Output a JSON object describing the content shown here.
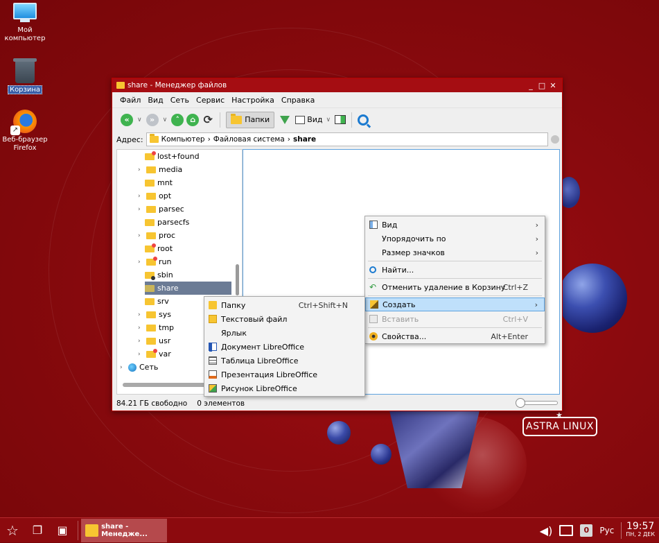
{
  "desktop": {
    "icons": [
      {
        "label": "Мой\nкомпьютер",
        "line1": "Мой",
        "line2": "компьютер"
      },
      {
        "label": "Корзина"
      },
      {
        "label_line1": "Веб-браузер",
        "label_line2": "Firefox"
      }
    ],
    "logo": "ASTRA LINUX"
  },
  "window": {
    "title": "share - Менеджер файлов",
    "controls": {
      "minimize": "_",
      "maximize": "□",
      "close": "✕"
    },
    "menu": [
      "Файл",
      "Вид",
      "Сеть",
      "Сервис",
      "Настройка",
      "Справка"
    ],
    "toolbar": {
      "folders_label": "Папки",
      "view_label": "Вид"
    },
    "address": {
      "label": "Адрес:",
      "crumbs": [
        "Компьютер",
        "Файловая система",
        "share"
      ]
    },
    "tree": [
      {
        "name": "lost+found",
        "expandable": false
      },
      {
        "name": "media",
        "expandable": true
      },
      {
        "name": "mnt",
        "expandable": false
      },
      {
        "name": "opt",
        "expandable": true
      },
      {
        "name": "parsec",
        "expandable": true
      },
      {
        "name": "parsecfs",
        "expandable": false
      },
      {
        "name": "proc",
        "expandable": true
      },
      {
        "name": "root",
        "expandable": false
      },
      {
        "name": "run",
        "expandable": true
      },
      {
        "name": "sbin",
        "expandable": false
      },
      {
        "name": "share",
        "expandable": false,
        "selected": true
      },
      {
        "name": "srv",
        "expandable": true
      },
      {
        "name": "sys",
        "expandable": true
      },
      {
        "name": "tmp",
        "expandable": true
      },
      {
        "name": "usr",
        "expandable": true
      },
      {
        "name": "var",
        "expandable": true
      },
      {
        "name": "Сеть",
        "expandable": true
      }
    ],
    "status": {
      "free": "84.21 ГБ свободно",
      "count": "0 элементов"
    }
  },
  "context_menu": {
    "items": [
      {
        "label": "Вид",
        "submenu": true
      },
      {
        "label": "Упорядочить по",
        "submenu": true
      },
      {
        "label": "Размер значков",
        "submenu": true
      },
      {
        "label": "Найти..."
      },
      {
        "label": "Отменить удаление в Корзину",
        "shortcut": "Ctrl+Z"
      },
      {
        "label": "Создать",
        "submenu": true,
        "highlighted": true
      },
      {
        "label": "Вставить",
        "shortcut": "Ctrl+V",
        "disabled": true
      },
      {
        "label": "Свойства...",
        "shortcut": "Alt+Enter"
      }
    ]
  },
  "create_submenu": {
    "items": [
      {
        "label": "Папку",
        "shortcut": "Ctrl+Shift+N"
      },
      {
        "label": "Текстовый файл"
      },
      {
        "label": "Ярлык"
      },
      {
        "label": "Документ LibreOffice"
      },
      {
        "label": "Таблица LibreOffice"
      },
      {
        "label": "Презентация LibreOffice"
      },
      {
        "label": "Рисунок LibreOffice"
      }
    ]
  },
  "taskbar": {
    "task_label": "share - Менедже...",
    "workspace": "0",
    "lang": "Рус",
    "time": "19:57",
    "date": "ПН, 2 ДЕК"
  },
  "colors": {
    "desktop": "#8a0a0e",
    "selection": "#6b7b95",
    "highlight": "#bfe0fb",
    "accent": "#5fa3df"
  }
}
